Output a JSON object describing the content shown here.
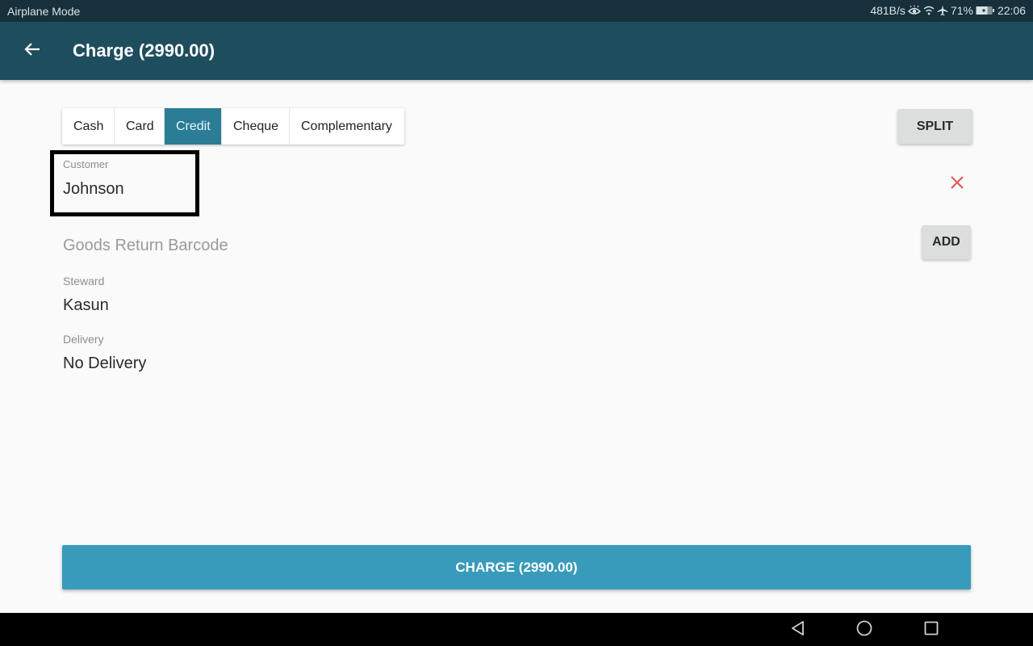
{
  "status_bar": {
    "mode": "Airplane Mode",
    "net_speed": "481B/s",
    "battery_percent": "71%",
    "time": "22:06",
    "icons": [
      "eye-icon",
      "wifi-icon",
      "airplane-icon",
      "battery-icon"
    ]
  },
  "app_bar": {
    "back_icon": "arrow-left-icon",
    "title": "Charge (2990.00)"
  },
  "payment_tabs": {
    "active": "Credit",
    "items": [
      {
        "label": "Cash"
      },
      {
        "label": "Card"
      },
      {
        "label": "Credit"
      },
      {
        "label": "Cheque"
      },
      {
        "label": "Complementary"
      }
    ]
  },
  "split_button": {
    "label": "SPLIT"
  },
  "customer": {
    "label": "Customer",
    "value": "Johnson",
    "clear_icon": "close-icon",
    "clear_color": "#e05a5a"
  },
  "goods_return": {
    "placeholder": "Goods Return Barcode",
    "add_label": "ADD"
  },
  "steward": {
    "label": "Steward",
    "value": "Kasun"
  },
  "delivery": {
    "label": "Delivery",
    "value": "No Delivery"
  },
  "charge_button": {
    "label": "CHARGE (2990.00)",
    "color": "#389bbb"
  },
  "colors": {
    "app_bar": "#1e4e5e",
    "status_bar": "#16313b",
    "active_tab": "#2b7d96"
  },
  "nav_bar": {
    "buttons": [
      "back-triangle-icon",
      "home-circle-icon",
      "recents-square-icon"
    ]
  }
}
